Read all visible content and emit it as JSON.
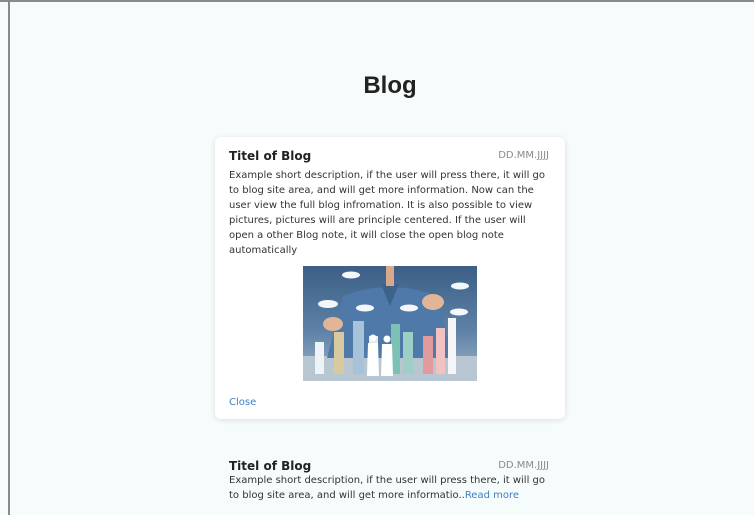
{
  "page": {
    "title": "Blog"
  },
  "posts": [
    {
      "title": "Titel of Blog",
      "date": "DD.MM.JJJJ",
      "text": "Example short description, if the user will press there, it will go to blog site area, and will get more information. Now can the user view the full blog infromation. It is also possible to view pictures, pictures will are principle centered. If the user will open a other Blog note, it will close the open blog note automatically",
      "close_label": "Close",
      "image": {
        "icon": "business-city-photo"
      }
    },
    {
      "title": "Titel of Blog",
      "date": "DD.MM.JJJJ",
      "text": "Example short description, if the user will press there, it will go to blog site area, and will get more informatio..",
      "read_more_label": "Read more"
    }
  ],
  "colors": {
    "link": "#3f7fc1",
    "background": "#f6fbfb",
    "date": "#8a8a8a"
  }
}
